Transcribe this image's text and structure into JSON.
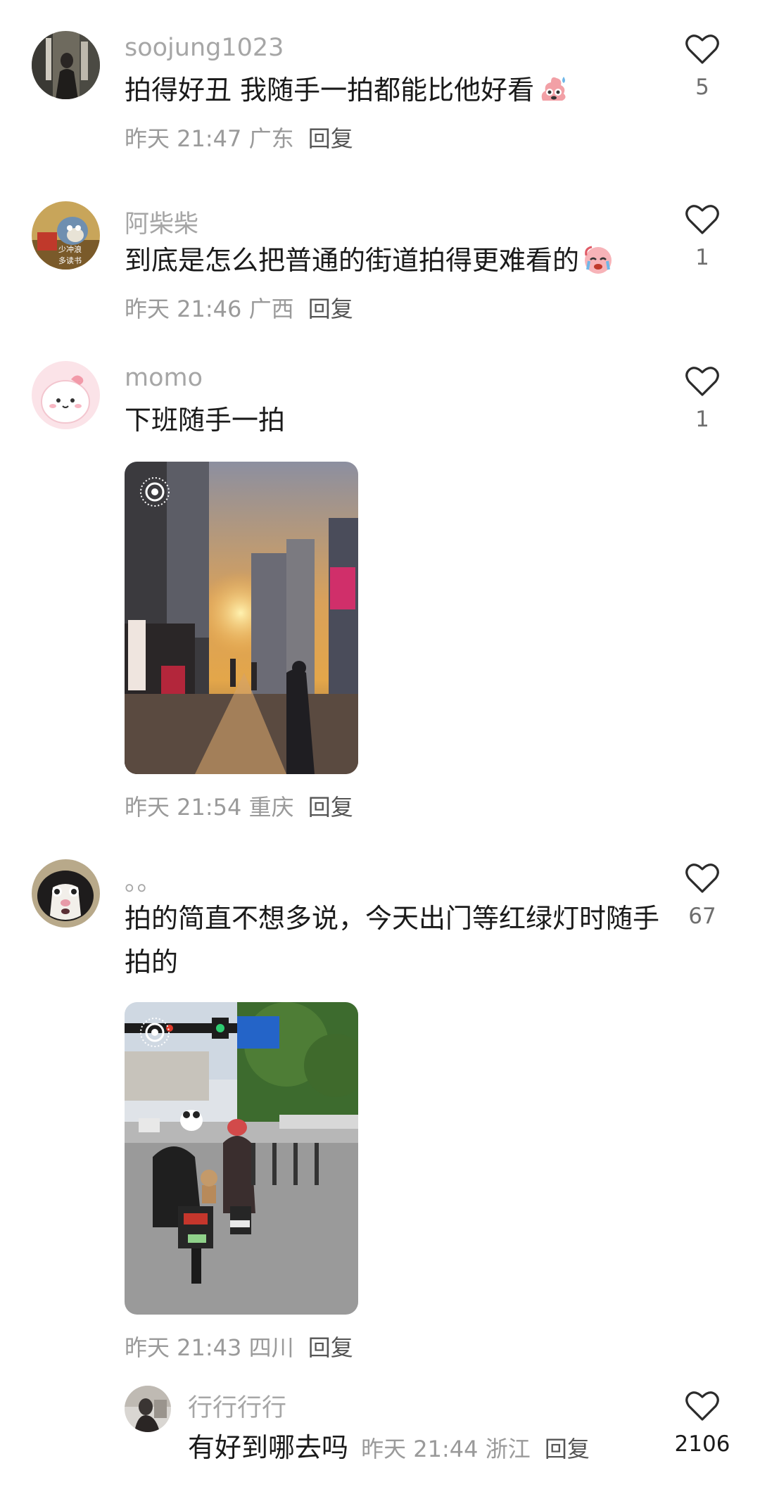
{
  "comments": [
    {
      "username": "soojung1023",
      "text": "拍得好丑 我随手一拍都能比他好看",
      "emoji": "sweat-poop-emoji",
      "time": "昨天 21:47",
      "location": "广东",
      "reply": "回复",
      "likes": "5"
    },
    {
      "username": "阿柴柴",
      "text": "到底是怎么把普通的街道拍得更难看的",
      "emoji": "crying-face-emoji",
      "time": "昨天 21:46",
      "location": "广西",
      "reply": "回复",
      "likes": "1"
    },
    {
      "username": "momo",
      "text": "下班随手一拍",
      "photo": "sunset-street-photo",
      "time": "昨天 21:54",
      "location": "重庆",
      "reply": "回复",
      "likes": "1"
    },
    {
      "username": "。。",
      "text": "拍的简直不想多说，今天出门等红绿灯时随手拍的",
      "photo": "scooter-street-photo",
      "time": "昨天 21:43",
      "location": "四川",
      "reply": "回复",
      "likes": "67"
    }
  ],
  "sub_reply": {
    "username": "行行行行",
    "text": "有好到哪去吗",
    "time": "昨天 21:44",
    "location": "浙江",
    "reply": "回复",
    "likes": "2106"
  },
  "colors": {
    "username": "#a6a6a6",
    "text": "#1a1a1a",
    "meta": "#9a9a9a",
    "reply": "#555555",
    "heart": "#2b2b2b"
  }
}
